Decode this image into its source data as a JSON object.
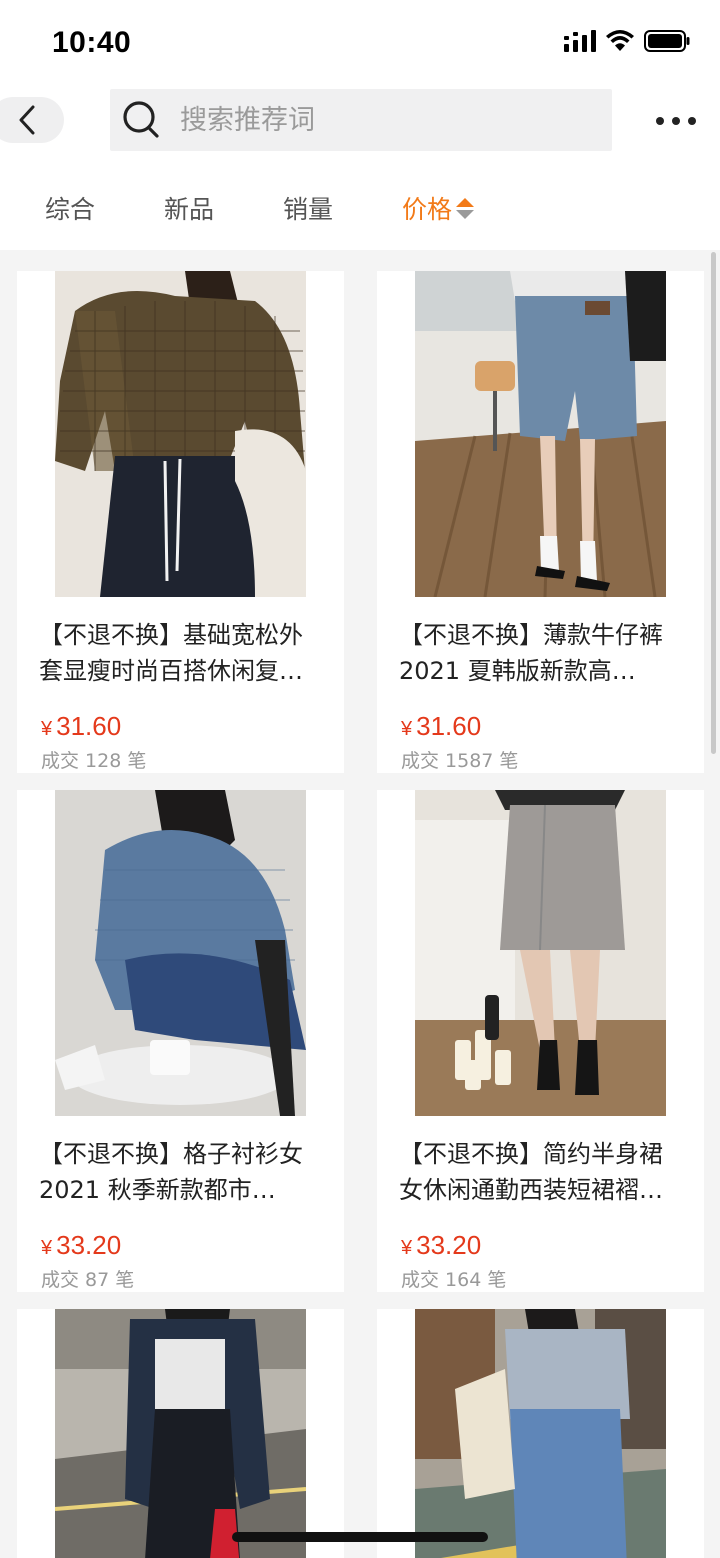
{
  "status_bar": {
    "time": "10:40"
  },
  "search": {
    "placeholder": "搜索推荐词"
  },
  "sort_tabs": [
    {
      "label": "综合",
      "active": false
    },
    {
      "label": "新品",
      "active": false
    },
    {
      "label": "销量",
      "active": false
    },
    {
      "label": "价格",
      "active": true
    }
  ],
  "products": [
    {
      "title": "【不退不换】基础宽松外套显瘦时尚百搭休闲复…",
      "currency": "¥",
      "price": "31.60",
      "sales": "成交 128 笔"
    },
    {
      "title": "【不退不换】薄款牛仔裤 2021 夏韩版新款高…",
      "currency": "¥",
      "price": "31.60",
      "sales": "成交 1587 笔"
    },
    {
      "title": "【不退不换】格子衬衫女 2021 秋季新款都市…",
      "currency": "¥",
      "price": "33.20",
      "sales": "成交 87 笔"
    },
    {
      "title": "【不退不换】简约半身裙女休闲通勤西装短裙褶…",
      "currency": "¥",
      "price": "33.20",
      "sales": "成交 164 笔"
    },
    {
      "title": "",
      "currency": "",
      "price": "",
      "sales": ""
    },
    {
      "title": "",
      "currency": "",
      "price": "",
      "sales": ""
    }
  ],
  "colors": {
    "accent": "#f27a18",
    "price": "#e4391b"
  }
}
